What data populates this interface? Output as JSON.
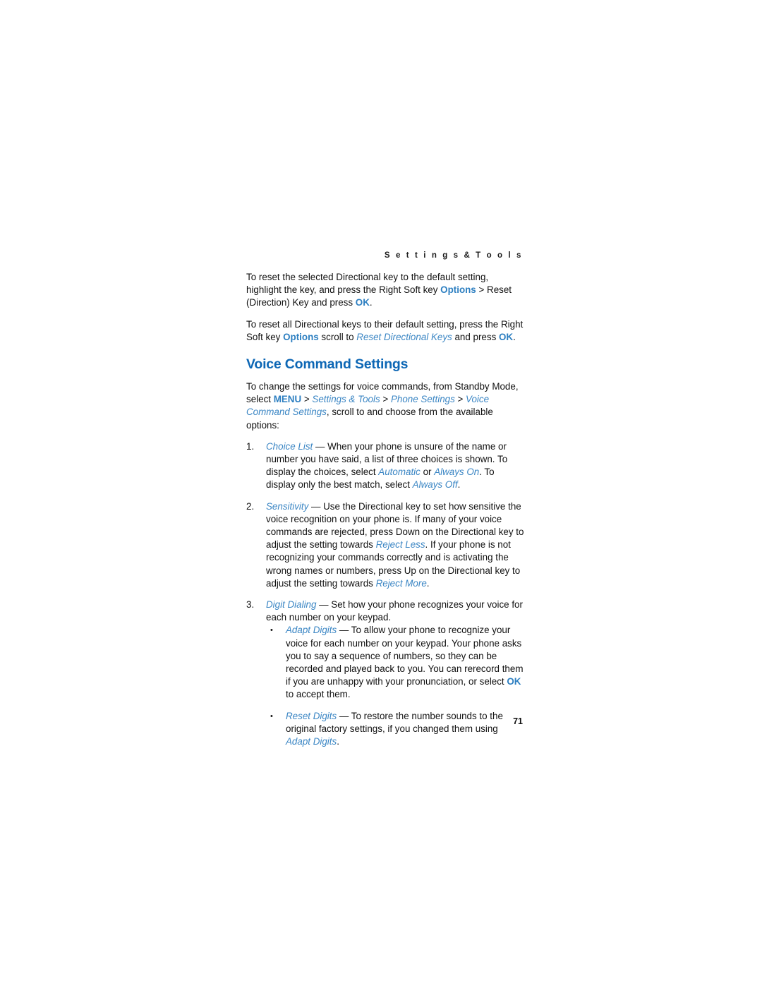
{
  "page": {
    "running_head": "S e t t i n g s   &   T o o l s",
    "folio": "71"
  },
  "body": {
    "para1": {
      "seg1": "To reset the selected Directional key to the default setting, highlight the key, and press the Right Soft key ",
      "kw1": "Options",
      "seg2": " > Reset (Direction) Key and press ",
      "kw2": "OK",
      "seg3": "."
    },
    "para2": {
      "seg1": "To reset all Directional keys to their default setting, press the Right Soft key ",
      "kw1": "Options",
      "seg2": " scroll to ",
      "kw2": "Reset Directional Keys",
      "seg3": " and press ",
      "kw3": "OK",
      "seg4": "."
    },
    "heading": "Voice Command Settings",
    "para3": {
      "seg1": "To change the settings for voice commands, from Standby Mode, select ",
      "kw1": "MENU",
      "seg2": " > ",
      "kw2": "Settings & Tools",
      "seg3": " > ",
      "kw3": "Phone Settings",
      "seg4": " > ",
      "kw4": "Voice Command Settings",
      "seg5": ", scroll to and choose from the available options:"
    },
    "items": [
      {
        "marker": "1.",
        "kw1": "Choice List",
        "seg1": " — When your phone is unsure of the name or number you have said, a list of three choices is shown. To display the choices, select ",
        "kw2": "Automatic",
        "seg2": " or ",
        "kw3": "Always On",
        "seg3": ". To display only the best match, select ",
        "kw4": "Always Off",
        "seg4": "."
      },
      {
        "marker": "2.",
        "kw1": "Sensitivity",
        "seg1": " — Use the Directional key to set how sensitive the voice recognition on your phone is. If many of your voice commands are rejected, press Down on the Directional key to adjust the setting towards ",
        "kw2": "Reject Less",
        "seg2": ". If your phone is not recognizing your commands correctly and is activating the wrong names or numbers, press Up on the Directional key to adjust the setting towards ",
        "kw3": "Reject More",
        "seg3": "."
      },
      {
        "marker": "3.",
        "kw1": "Digit Dialing",
        "seg1": " — Set how your phone recognizes your voice for each number on your keypad."
      }
    ],
    "bullets": [
      {
        "bullet": "•",
        "kw1": "Adapt Digits",
        "seg1": " — To allow your phone to recognize your voice for each number on your keypad. Your phone asks you to say a sequence of numbers, so they can be recorded and played back to you. You can rerecord them if you are unhappy with your pronunciation, or select ",
        "kw2": "OK",
        "seg2": " to accept them."
      },
      {
        "bullet": "•",
        "kw1": "Reset Digits",
        "seg1": " — To restore the number sounds to the original factory settings, if you changed them using ",
        "kw2": "Adapt Digits",
        "seg2": "."
      }
    ]
  }
}
